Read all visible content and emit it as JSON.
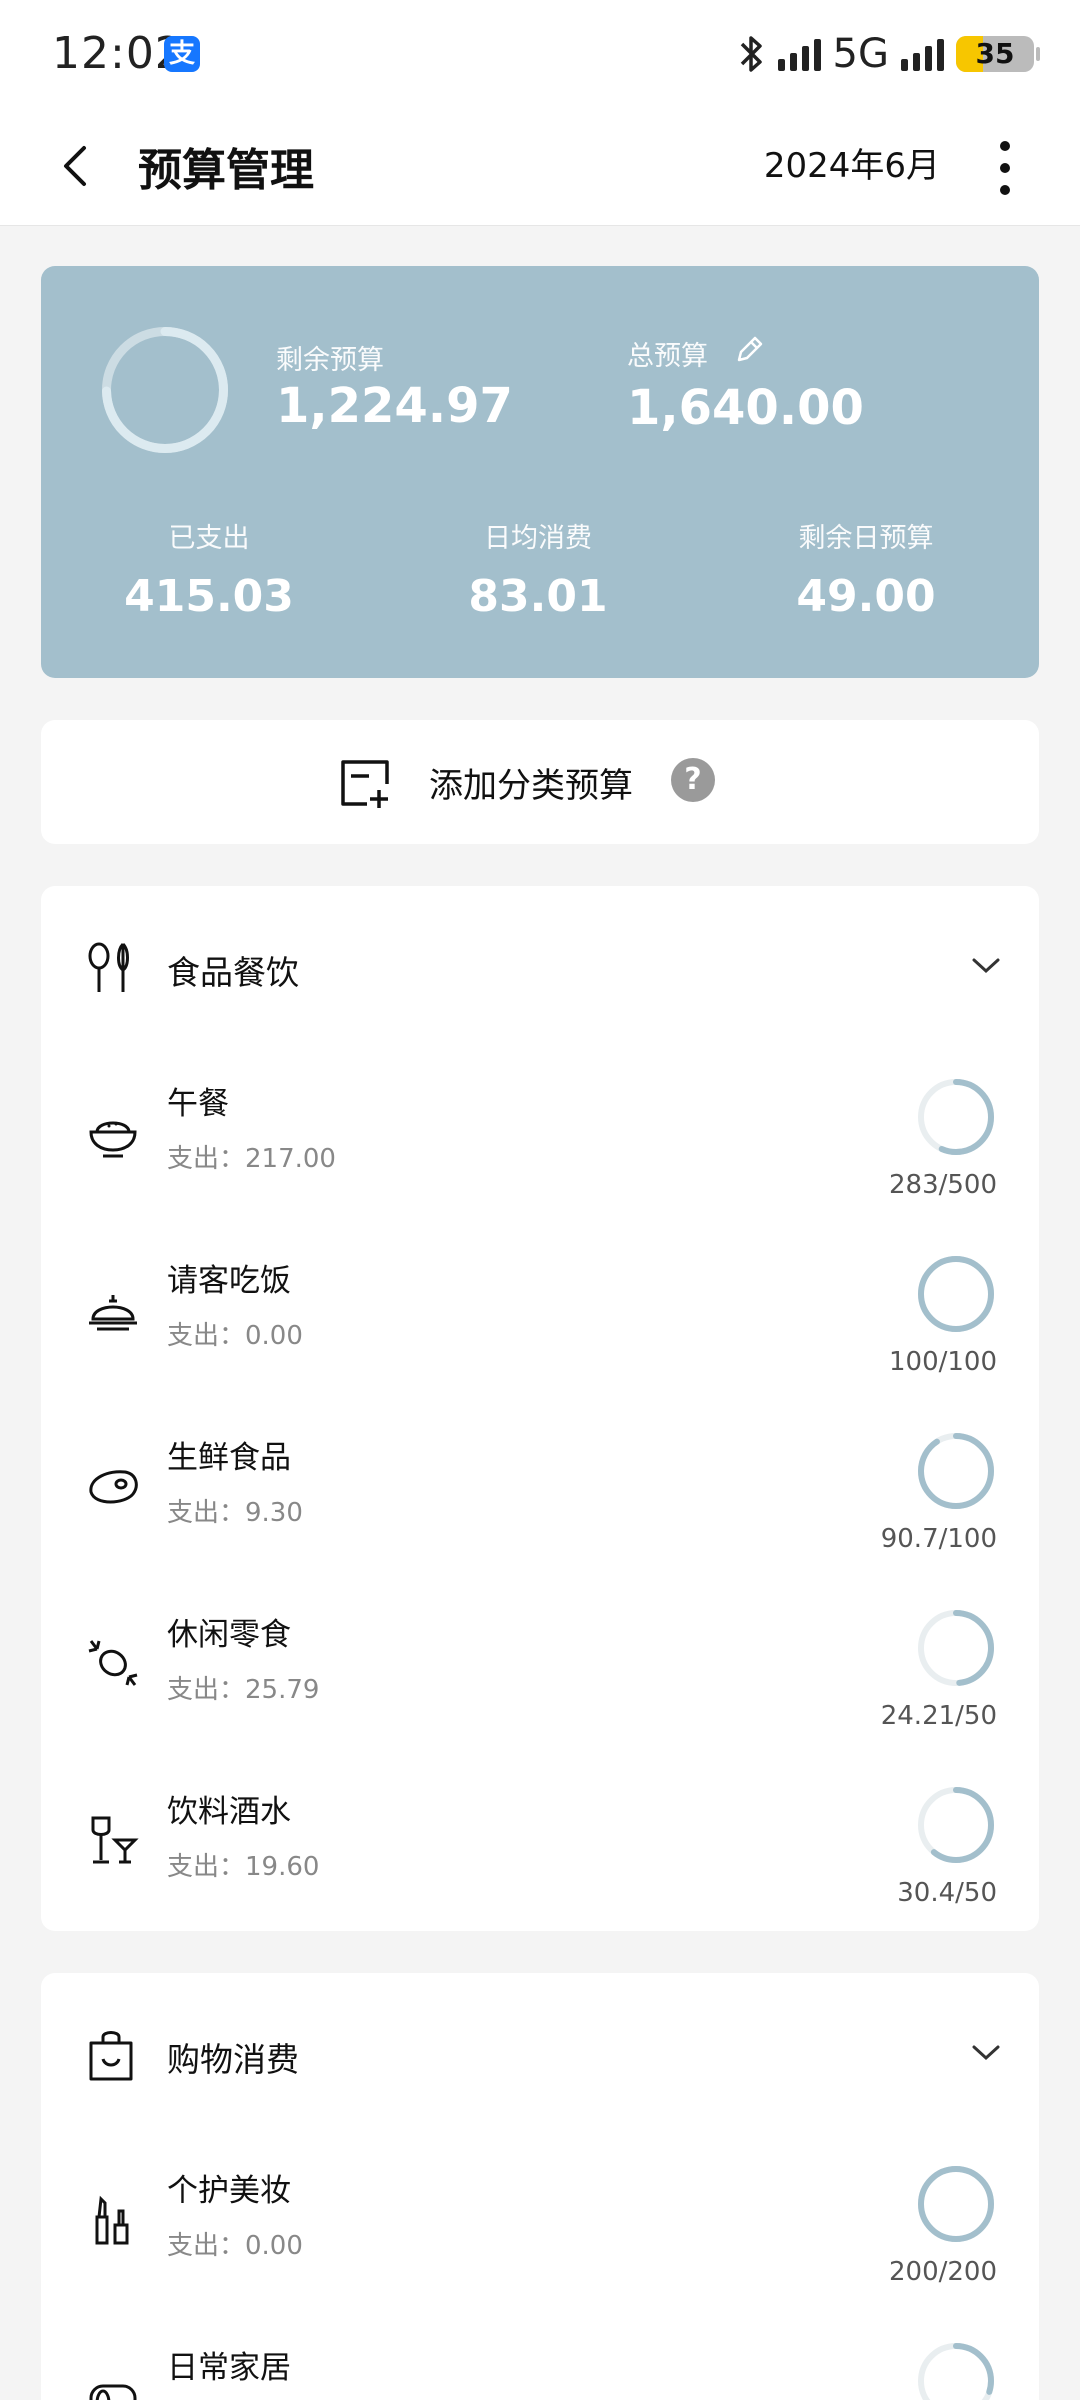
{
  "status_bar": {
    "time": "12:02",
    "app_badge": "支",
    "network": "5G",
    "battery": "35"
  },
  "header": {
    "title": "预算管理",
    "month": "2024年6月"
  },
  "summary": {
    "remaining_label": "剩余预算",
    "remaining_value": "1,224.97",
    "total_label": "总预算",
    "total_value": "1,640.00",
    "spent_label": "已支出",
    "spent_value": "415.03",
    "daily_avg_label": "日均消费",
    "daily_avg_value": "83.01",
    "daily_remaining_label": "剩余日预算",
    "daily_remaining_value": "49.00",
    "remaining_fraction": 0.747,
    "accent_color": "#a3bfcc"
  },
  "add_budget": {
    "label": "添加分类预算",
    "help": "?"
  },
  "categories": [
    {
      "name": "食品餐饮",
      "icon": "fork-spoon-icon",
      "items": [
        {
          "name": "午餐",
          "spent": "支出：217.00",
          "ratio": "283/500",
          "remaining_fraction": 0.566,
          "icon": "rice-bowl-icon"
        },
        {
          "name": "请客吃饭",
          "spent": "支出：0.00",
          "ratio": "100/100",
          "remaining_fraction": 1.0,
          "icon": "dish-cover-icon"
        },
        {
          "name": "生鲜食品",
          "spent": "支出：9.30",
          "ratio": "90.7/100",
          "remaining_fraction": 0.907,
          "icon": "meat-icon"
        },
        {
          "name": "休闲零食",
          "spent": "支出：25.79",
          "ratio": "24.21/50",
          "remaining_fraction": 0.484,
          "icon": "candy-icon"
        },
        {
          "name": "饮料酒水",
          "spent": "支出：19.60",
          "ratio": "30.4/50",
          "remaining_fraction": 0.608,
          "icon": "wine-glass-icon"
        }
      ]
    },
    {
      "name": "购物消费",
      "icon": "shopping-bag-icon",
      "items": [
        {
          "name": "个护美妆",
          "spent": "支出：0.00",
          "ratio": "200/200",
          "remaining_fraction": 1.0,
          "icon": "cosmetics-icon"
        },
        {
          "name": "日常家居",
          "spent": "",
          "ratio": "",
          "remaining_fraction": 0.3,
          "icon": "toilet-paper-icon"
        }
      ]
    }
  ]
}
